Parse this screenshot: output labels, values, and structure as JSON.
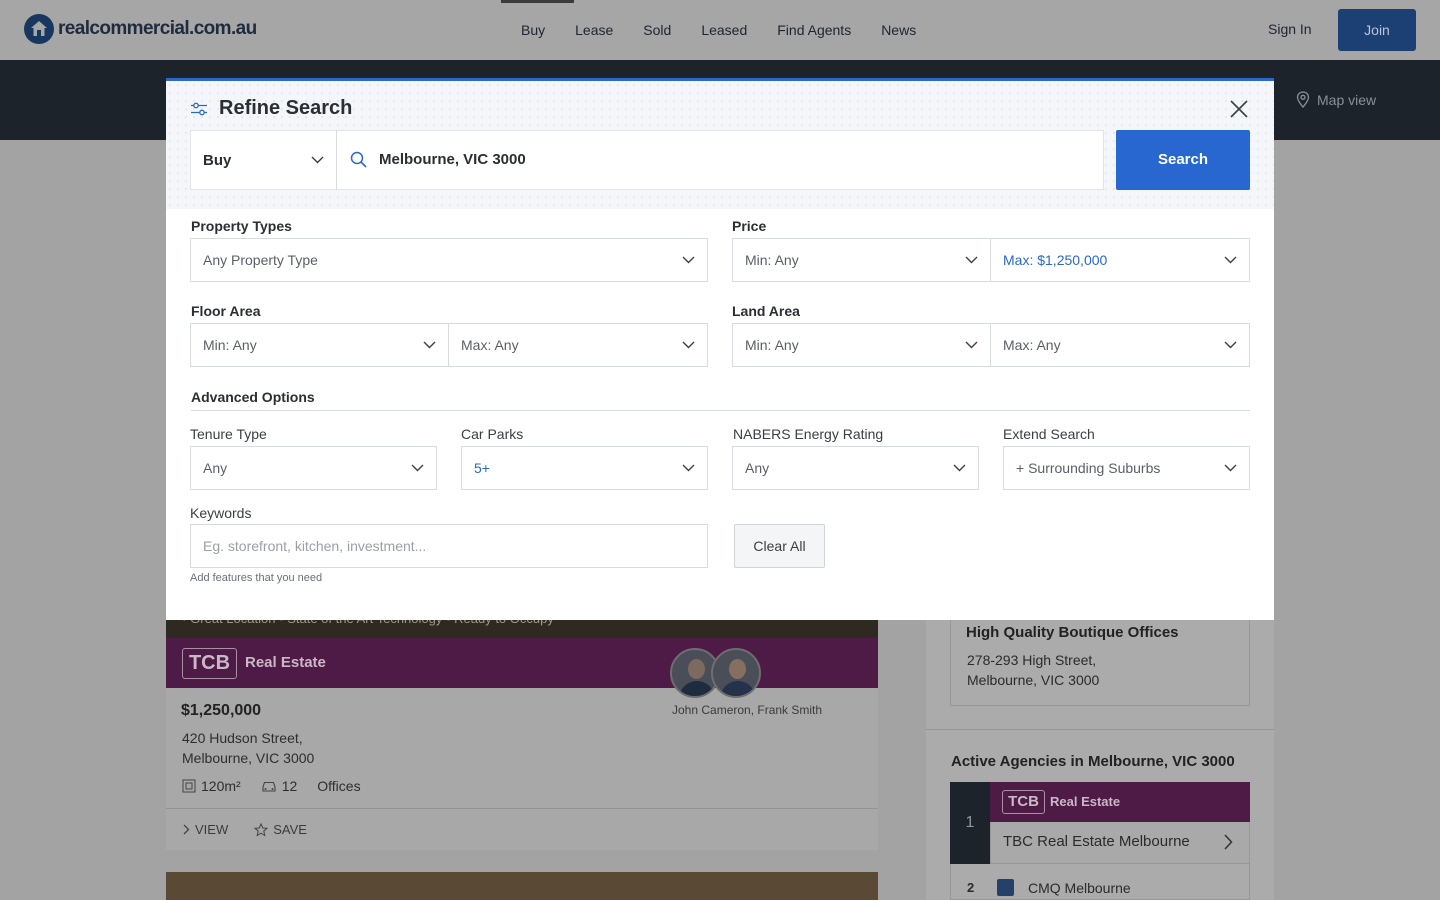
{
  "header": {
    "logo_text": "realcommercial.com.au",
    "nav": [
      "Buy",
      "Lease",
      "Sold",
      "Leased",
      "Find Agents",
      "News"
    ],
    "sign_in": "Sign In",
    "join": "Join"
  },
  "map_view": "Map view",
  "modal": {
    "title": "Refine Search",
    "search_mode": "Buy",
    "location": "Melbourne, VIC 3000",
    "search_button": "Search",
    "property_types": {
      "label": "Property Types",
      "value": "Any Property Type"
    },
    "price": {
      "label": "Price",
      "min": "Min: Any",
      "max": "Max: $1,250,000"
    },
    "floor_area": {
      "label": "Floor Area",
      "min": "Min: Any",
      "max": "Max: Any"
    },
    "land_area": {
      "label": "Land Area",
      "min": "Min: Any",
      "max": "Max: Any"
    },
    "advanced_title": "Advanced Options",
    "tenure": {
      "label": "Tenure Type",
      "value": "Any"
    },
    "car_parks": {
      "label": "Car Parks",
      "value": "5+"
    },
    "nabers": {
      "label": "NABERS Energy Rating",
      "value": "Any"
    },
    "extend": {
      "label": "Extend Search",
      "value": "+ Surrounding Suburbs"
    },
    "keywords": {
      "label": "Keywords",
      "placeholder": "Eg. storefront, kitchen, investment...",
      "hint": "Add features that you need"
    },
    "clear_all": "Clear All"
  },
  "listing": {
    "features": "• Great Location  •  State of the Art Technology  •  Ready to Occupy",
    "brand_logo": "TCB",
    "brand_name": "Real Estate",
    "agents": "John Cameron, Frank Smith",
    "price": "$1,250,000",
    "address_line1": "420 Hudson Street,",
    "address_line2": "Melbourne, VIC 3000",
    "floor_area": "120m²",
    "car_parks": "12",
    "category": "Offices",
    "view": "VIEW",
    "save": "SAVE"
  },
  "sidebar": {
    "featured_title": "High Quality Boutique Offices",
    "featured_addr1": "278-293 High Street,",
    "featured_addr2": "Melbourne, VIC 3000",
    "agencies_title": "Active Agencies in Melbourne, VIC 3000",
    "agencies": [
      {
        "rank": "1",
        "logo": "TCB",
        "logo_name": "Real Estate",
        "name": "TBC Real Estate Melbourne"
      },
      {
        "rank": "2",
        "name": "CMQ Melbourne"
      }
    ]
  },
  "colors": {
    "accent": "#2867d0",
    "brand_purple": "#8b2f7c",
    "dark_band": "#2d3642"
  }
}
